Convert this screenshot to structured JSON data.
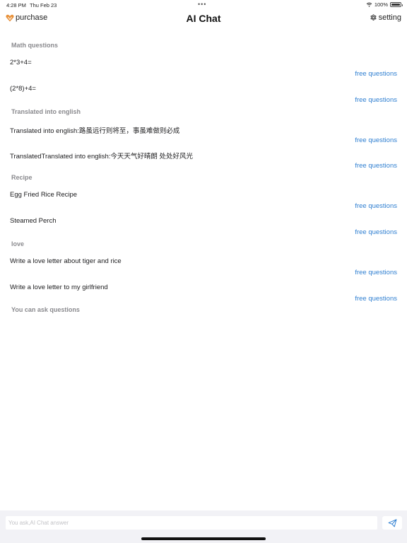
{
  "status_bar": {
    "time": "4:28 PM",
    "date": "Thu Feb 23",
    "battery": "100%",
    "battery_level": 1.0,
    "icons": [
      "wifi-icon",
      "battery-icon"
    ]
  },
  "nav": {
    "purchase_label": "purchase",
    "purchase_icon": "heart-diamond-icon",
    "title": "AI Chat",
    "setting_label": "setting",
    "setting_icon": "gear-icon"
  },
  "sections": [
    {
      "title": "Math questions",
      "questions": [
        {
          "text": "2*3+4=",
          "action": "free questions"
        },
        {
          "text": "(2*8)+4=",
          "action": "free questions"
        }
      ]
    },
    {
      "title": "Translated into english",
      "questions": [
        {
          "text": "Translated into english:路虽远行则将至，事虽难做则必成",
          "action": "free questions"
        },
        {
          "text": "TranslatedTranslated into english:今天天气好晴朗 处处好风光",
          "action": "free questions"
        }
      ]
    },
    {
      "title": "Recipe",
      "questions": [
        {
          "text": "Egg Fried Rice Recipe",
          "action": "free questions"
        },
        {
          "text": "Steamed Perch",
          "action": "free questions"
        }
      ]
    },
    {
      "title": "love",
      "questions": [
        {
          "text": "Write a love letter about tiger and rice",
          "action": "free questions"
        },
        {
          "text": "Write a love letter to my girlfriend",
          "action": "free questions"
        }
      ]
    },
    {
      "title": "You can ask questions",
      "questions": []
    }
  ],
  "input": {
    "placeholder": "You ask,AI Chat answer",
    "value": ""
  },
  "send_icon": "paper-plane-icon",
  "colors": {
    "link": "#2f7fd1",
    "accent": "#e8913a",
    "section_title": "#8a8a8e",
    "bottom_bar": "#f2f2f6"
  }
}
